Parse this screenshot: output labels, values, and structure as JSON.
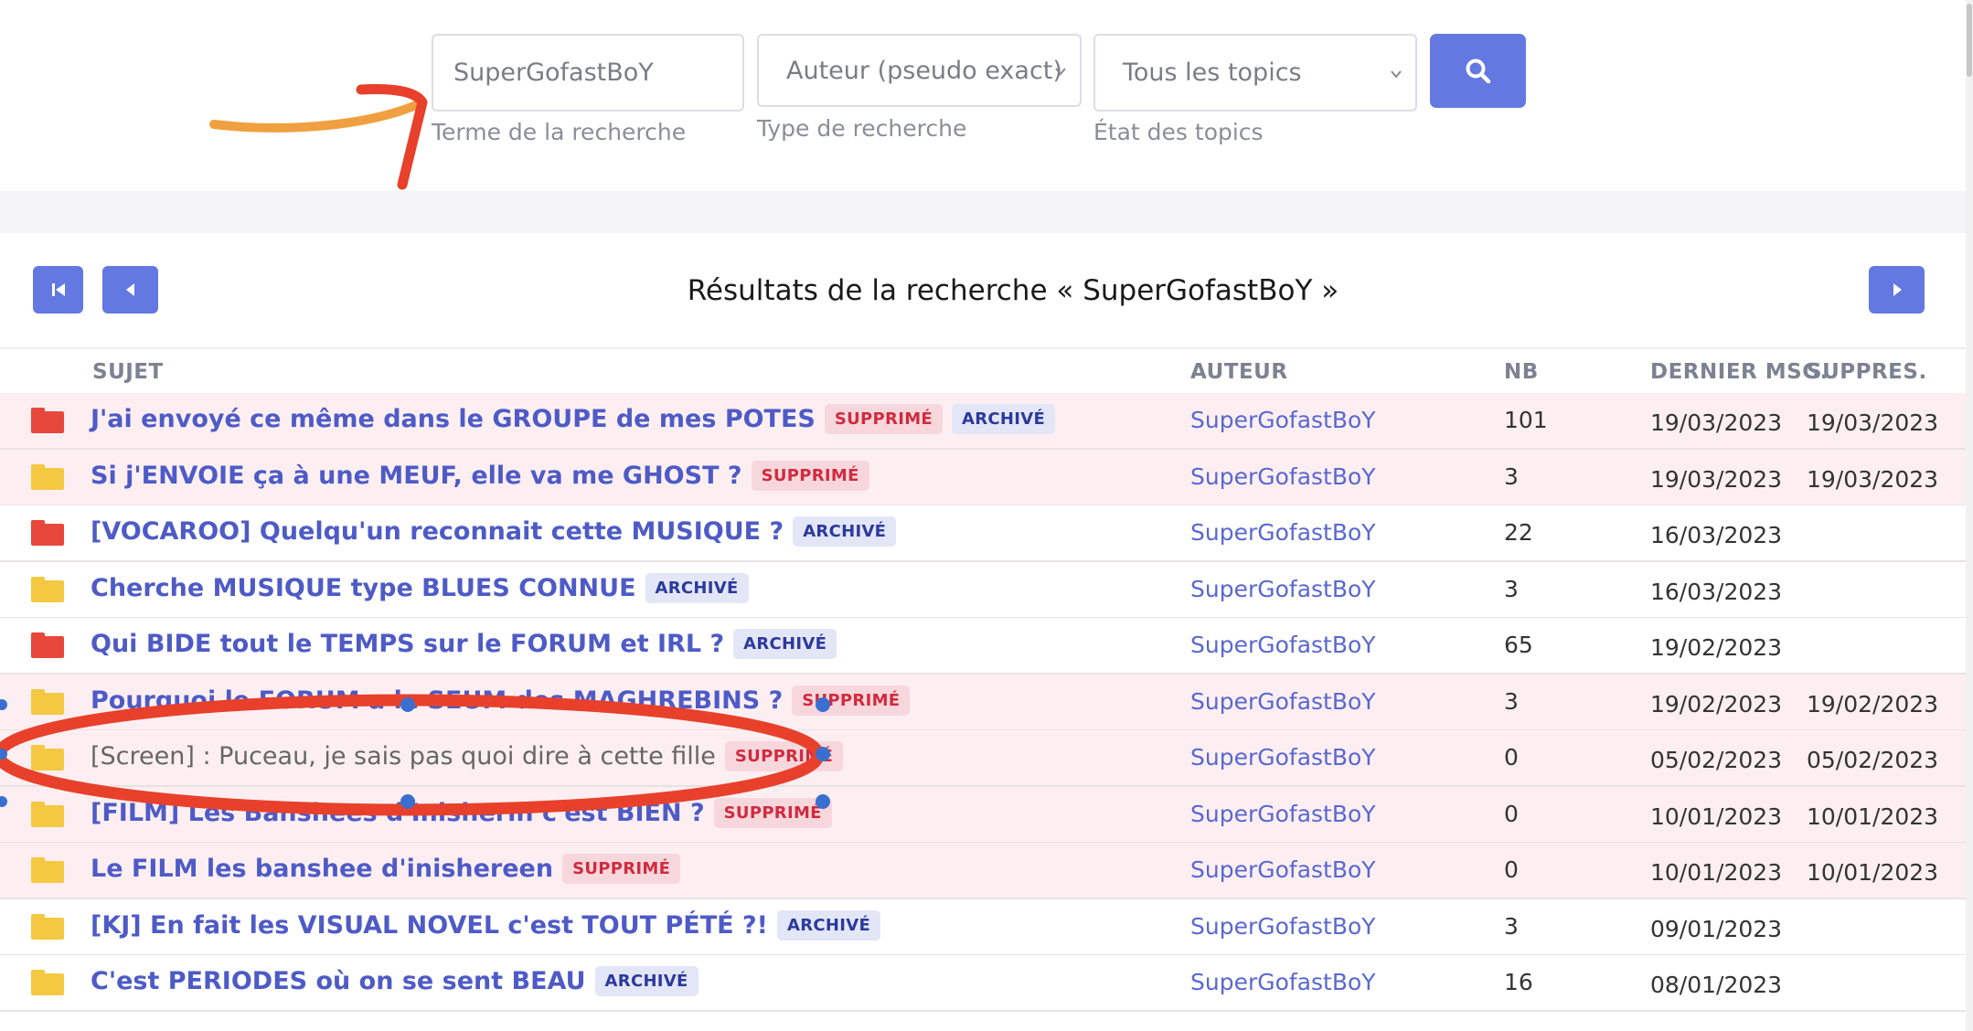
{
  "search": {
    "term_value": "SuperGofastBoY",
    "term_help": "Terme de la recherche",
    "type_value": "Auteur (pseudo exact)",
    "type_help": "Type de recherche",
    "state_value": "Tous les topics",
    "state_help": "État des topics"
  },
  "results": {
    "title": "Résultats de la recherche « SuperGofastBoY »"
  },
  "columns": {
    "subject": "SUJET",
    "author": "AUTEUR",
    "nb": "NB",
    "last": "DERNIER MSG.",
    "deleted": "SUPPRES."
  },
  "rows": [
    {
      "subject": "J'ai envoyé ce même dans le GROUPE de mes POTES",
      "badges": [
        "SUPPRIMÉ",
        "ARCHIVÉ"
      ],
      "author": "SuperGofastBoY",
      "nb": "101",
      "last": "19/03/2023",
      "deleted": "19/03/2023",
      "folder": "red",
      "bg": "deleted"
    },
    {
      "subject": "Si j'ENVOIE ça à une MEUF, elle va me GHOST ?",
      "badges": [
        "SUPPRIMÉ"
      ],
      "author": "SuperGofastBoY",
      "nb": "3",
      "last": "19/03/2023",
      "deleted": "19/03/2023",
      "folder": "yellow",
      "bg": "deleted"
    },
    {
      "subject": "[VOCAROO] Quelqu'un reconnait cette MUSIQUE ?",
      "badges": [
        "ARCHIVÉ"
      ],
      "author": "SuperGofastBoY",
      "nb": "22",
      "last": "16/03/2023",
      "deleted": "",
      "folder": "red",
      "bg": "normal"
    },
    {
      "subject": "Cherche MUSIQUE type BLUES CONNUE",
      "badges": [
        "ARCHIVÉ"
      ],
      "author": "SuperGofastBoY",
      "nb": "3",
      "last": "16/03/2023",
      "deleted": "",
      "folder": "yellow",
      "bg": "normal"
    },
    {
      "subject": "Qui BIDE tout le TEMPS sur le FORUM et IRL ?",
      "badges": [
        "ARCHIVÉ"
      ],
      "author": "SuperGofastBoY",
      "nb": "65",
      "last": "19/02/2023",
      "deleted": "",
      "folder": "red",
      "bg": "normal"
    },
    {
      "subject": "Pourquoi le FORUM a le SEUM des MAGHREBINS ?",
      "badges": [
        "SUPPRIMÉ"
      ],
      "author": "SuperGofastBoY",
      "nb": "3",
      "last": "19/02/2023",
      "deleted": "19/02/2023",
      "folder": "yellow",
      "bg": "deleted"
    },
    {
      "subject": "[Screen] : Puceau, je sais pas quoi dire à cette fille",
      "badges": [
        "SUPPRIMÉ"
      ],
      "author": "SuperGofastBoY",
      "nb": "0",
      "last": "05/02/2023",
      "deleted": "05/02/2023",
      "folder": "yellow",
      "bg": "deleted",
      "grey": true
    },
    {
      "subject": "[FILM] Les Banshees d'Inisherin c'est BIEN ?",
      "badges": [
        "SUPPRIMÉ"
      ],
      "author": "SuperGofastBoY",
      "nb": "0",
      "last": "10/01/2023",
      "deleted": "10/01/2023",
      "folder": "yellow",
      "bg": "deleted"
    },
    {
      "subject": "Le FILM les banshee d'inishereen",
      "badges": [
        "SUPPRIMÉ"
      ],
      "author": "SuperGofastBoY",
      "nb": "0",
      "last": "10/01/2023",
      "deleted": "10/01/2023",
      "folder": "yellow",
      "bg": "deleted"
    },
    {
      "subject": "[KJ] En fait les VISUAL NOVEL c'est TOUT PÉTÉ ?!",
      "badges": [
        "ARCHIVÉ"
      ],
      "author": "SuperGofastBoY",
      "nb": "3",
      "last": "09/01/2023",
      "deleted": "",
      "folder": "yellow",
      "bg": "normal"
    },
    {
      "subject": "C'est PERIODES où on se sent BEAU",
      "badges": [
        "ARCHIVÉ"
      ],
      "author": "SuperGofastBoY",
      "nb": "16",
      "last": "08/01/2023",
      "deleted": "",
      "folder": "yellow",
      "bg": "normal"
    }
  ],
  "colors": {
    "accent": "#6378e0",
    "link": "#4e5bc6",
    "deleted_row_bg": "#fdeff1",
    "badge_deleted": "#d02b3f",
    "badge_archived": "#2b3a9b",
    "annotation": "#e8402b"
  },
  "icons": {
    "search": "search-icon",
    "first_page": "first-page-icon",
    "prev_page": "chevron-left-icon",
    "next_page": "chevron-right-icon",
    "folder": "folder-icon"
  }
}
